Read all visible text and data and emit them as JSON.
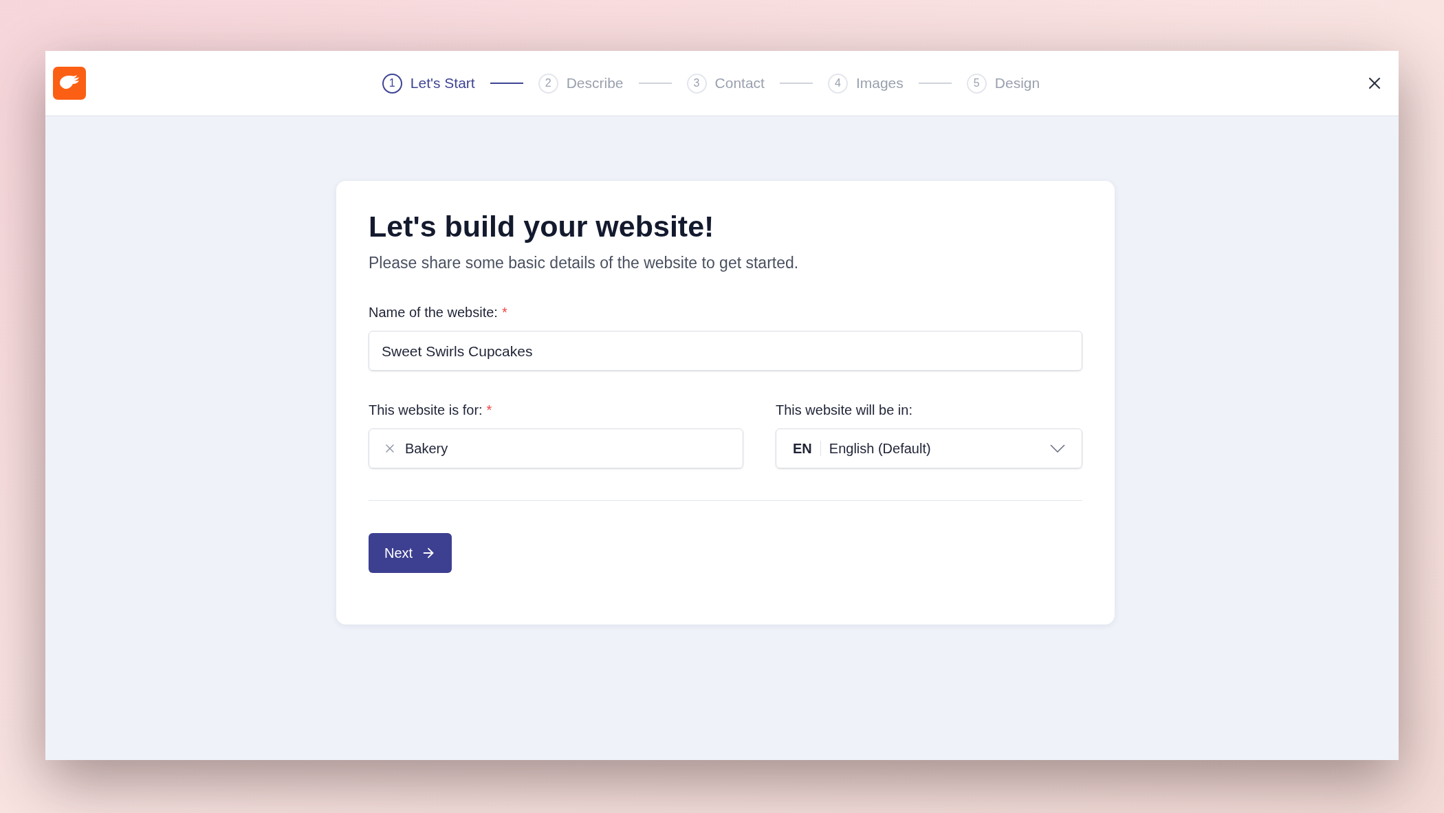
{
  "steps": [
    {
      "number": "1",
      "label": "Let's Start",
      "selected": true
    },
    {
      "number": "2",
      "label": "Describe",
      "selected": false
    },
    {
      "number": "3",
      "label": "Contact",
      "selected": false
    },
    {
      "number": "4",
      "label": "Images",
      "selected": false
    },
    {
      "number": "5",
      "label": "Design",
      "selected": false
    }
  ],
  "card": {
    "title": "Let's build your website!",
    "subtitle": "Please share some basic details of the website to get started.",
    "name_field": {
      "label": "Name of the website:",
      "required_mark": "*",
      "value": "Sweet Swirls Cupcakes"
    },
    "category_field": {
      "label": "This website is for:",
      "required_mark": "*",
      "value": "Bakery"
    },
    "language_field": {
      "label": "This website will be in:",
      "code": "EN",
      "value": "English (Default)"
    },
    "next_button": "Next"
  }
}
